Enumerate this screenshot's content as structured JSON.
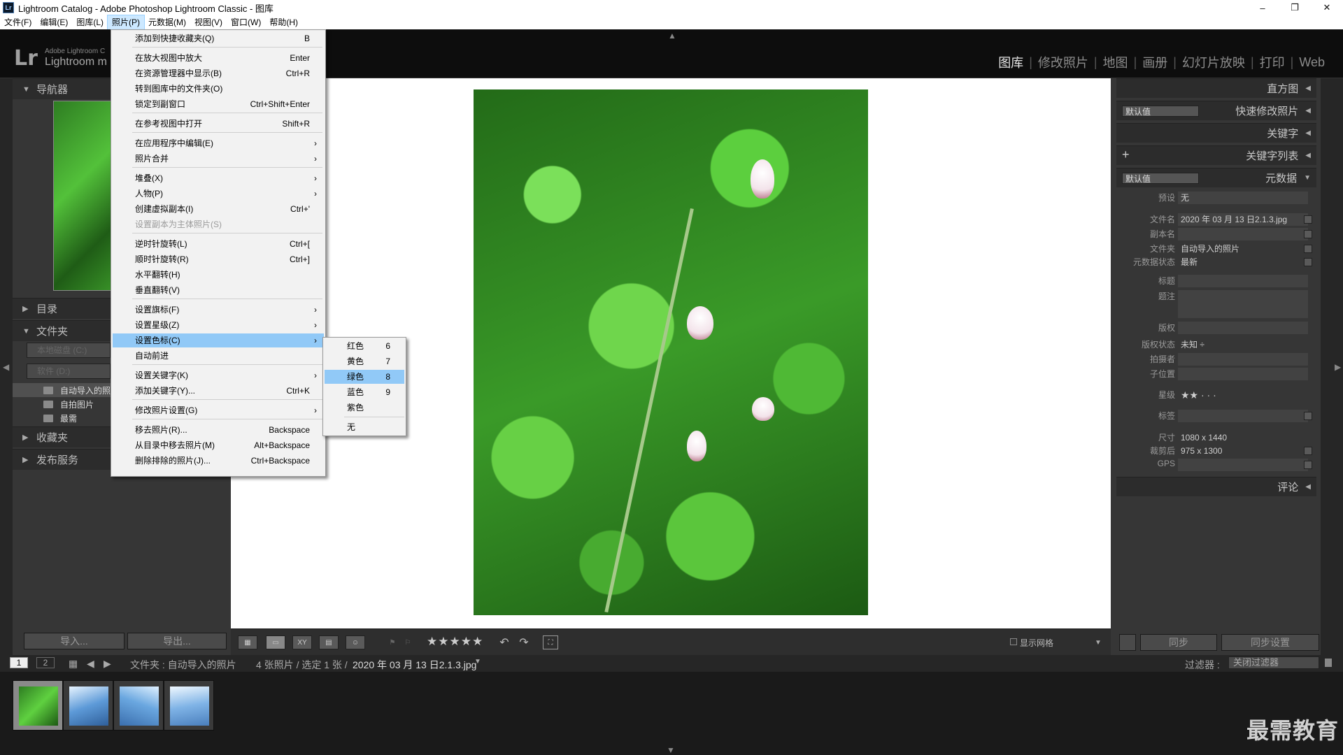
{
  "window": {
    "title": "Lightroom Catalog - Adobe Photoshop Lightroom Classic - 图库",
    "app_icon": "Lr",
    "controls": [
      "–",
      "❐",
      "✕"
    ]
  },
  "menubar": [
    "文件(F)",
    "编辑(E)",
    "图库(L)",
    "照片(P)",
    "元数据(M)",
    "视图(V)",
    "窗口(W)",
    "帮助(H)"
  ],
  "header": {
    "logo": "Lr",
    "brand_small": "Adobe Lightroom C",
    "brand_big": "Lightroom m",
    "modules": [
      "图库",
      "修改照片",
      "地图",
      "画册",
      "幻灯片放映",
      "打印",
      "Web"
    ],
    "active_module": "图库"
  },
  "left_panel": {
    "navigator": "导航器",
    "catalog": "目录",
    "folders": "文件夹",
    "disk1": "本地磁盘 (C:)",
    "disk2": "软件 (D:)",
    "folder_items": [
      "自动导入的照",
      "自拍图片",
      "最需"
    ],
    "collections": "收藏夹",
    "publish": "发布服务",
    "import": "导入...",
    "export": "导出..."
  },
  "photo_menu": {
    "items": [
      {
        "label": "添加到快捷收藏夹(Q)",
        "shortcut": "B"
      },
      {
        "label": "在放大视图中放大",
        "shortcut": "Enter"
      },
      {
        "label": "在资源管理器中显示(B)",
        "shortcut": "Ctrl+R"
      },
      {
        "label": "转到图库中的文件夹(O)",
        "shortcut": ""
      },
      {
        "label": "锁定到副窗口",
        "shortcut": "Ctrl+Shift+Enter"
      },
      {
        "label": "在参考视图中打开",
        "shortcut": "Shift+R"
      },
      {
        "label": "在应用程序中编辑(E)",
        "shortcut": "",
        "arrow": "›"
      },
      {
        "label": "照片合并",
        "shortcut": "",
        "arrow": "›"
      },
      {
        "label": "堆叠(X)",
        "shortcut": "",
        "arrow": "›"
      },
      {
        "label": "人物(P)",
        "shortcut": "",
        "arrow": "›"
      },
      {
        "label": "创建虚拟副本(I)",
        "shortcut": "Ctrl+'"
      },
      {
        "label": "设置副本为主体照片(S)",
        "shortcut": ""
      },
      {
        "label": "逆时针旋转(L)",
        "shortcut": "Ctrl+["
      },
      {
        "label": "顺时针旋转(R)",
        "shortcut": "Ctrl+]"
      },
      {
        "label": "水平翻转(H)",
        "shortcut": ""
      },
      {
        "label": "垂直翻转(V)",
        "shortcut": ""
      },
      {
        "label": "设置旗标(F)",
        "shortcut": "",
        "arrow": "›"
      },
      {
        "label": "设置星级(Z)",
        "shortcut": "",
        "arrow": "›"
      },
      {
        "label": "设置色标(C)",
        "shortcut": "",
        "arrow": "›"
      },
      {
        "label": "自动前进",
        "shortcut": ""
      },
      {
        "label": "设置关键字(K)",
        "shortcut": "",
        "arrow": "›"
      },
      {
        "label": "添加关键字(Y)...",
        "shortcut": "Ctrl+K"
      },
      {
        "label": "修改照片设置(G)",
        "shortcut": "",
        "arrow": "›"
      },
      {
        "label": "移去照片(R)...",
        "shortcut": "Backspace"
      },
      {
        "label": "从目录中移去照片(M)",
        "shortcut": "Alt+Backspace"
      },
      {
        "label": "删除排除的照片(J)...",
        "shortcut": "Ctrl+Backspace"
      }
    ]
  },
  "color_submenu": {
    "items": [
      {
        "label": "红色",
        "shortcut": "6"
      },
      {
        "label": "黄色",
        "shortcut": "7"
      },
      {
        "label": "绿色",
        "shortcut": "8"
      },
      {
        "label": "蓝色",
        "shortcut": "9"
      },
      {
        "label": "紫色",
        "shortcut": ""
      },
      {
        "label": "无",
        "shortcut": ""
      }
    ]
  },
  "right_panel": {
    "histogram": "直方图",
    "quick_develop": "快速修改照片",
    "quick_develop_preset": "默认值",
    "keywording": "关键字",
    "keyword_list": "关键字列表",
    "metadata": "元数据",
    "metadata_preset": "默认值",
    "comments": "评论",
    "sync": "同步",
    "sync_settings": "同步设置",
    "fields": {
      "preset_label": "预设",
      "preset_value": "无",
      "filename_label": "文件名",
      "filename_value": "2020 年 03 月 13 日2.1.3.jpg",
      "copyname_label": "副本名",
      "copyname_value": "",
      "folder_label": "文件夹",
      "folder_value": "自动导入的照片",
      "metastatus_label": "元数据状态",
      "metastatus_value": "最新",
      "title_label": "标题",
      "caption_label": "题注",
      "copyright_label": "版权",
      "copyright_status_label": "版权状态",
      "copyright_status_value": "未知 ÷",
      "creator_label": "拍摄者",
      "sublocation_label": "子位置",
      "rating_label": "星级",
      "rating_value": "★★ · · ·",
      "label_label": "标签",
      "dimensions_label": "尺寸",
      "dimensions_value": "1080 x 1440",
      "cropped_label": "裁剪后",
      "cropped_value": "975 x 1300",
      "gps_label": "GPS"
    }
  },
  "toolbar": {
    "rating": "★★★★★",
    "show_grid": "显示网格"
  },
  "filmbar": {
    "page1": "1",
    "page2": "2",
    "source": "文件夹 : 自动导入的照片",
    "count": "4 张照片 / 选定 1 张 /",
    "filename": "2020 年 03 月 13 日2.1.3.jpg",
    "filter_label": "过滤器 :",
    "filter_value": "关闭过滤器"
  },
  "watermark": "最需教育"
}
